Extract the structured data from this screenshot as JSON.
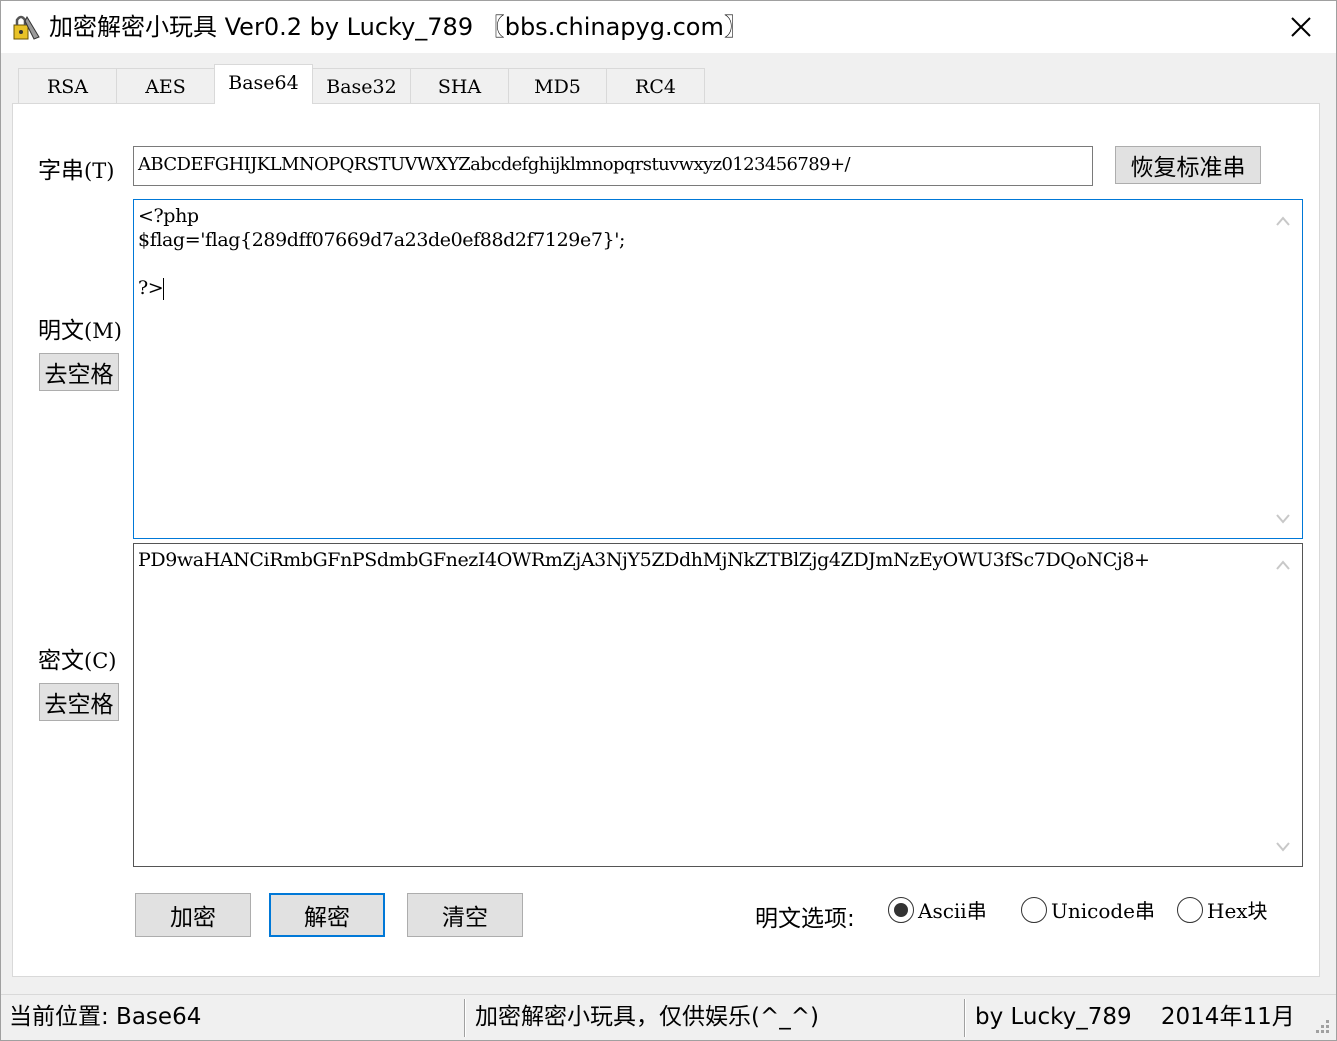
{
  "window": {
    "title": "加密解密小玩具 Ver0.2 by Lucky_789 〖bbs.chinapyg.com〗"
  },
  "tabs": [
    {
      "label": "RSA",
      "active": false
    },
    {
      "label": "AES",
      "active": false
    },
    {
      "label": "Base64",
      "active": true
    },
    {
      "label": "Base32",
      "active": false
    },
    {
      "label": "SHA",
      "active": false
    },
    {
      "label": "MD5",
      "active": false
    },
    {
      "label": "RC4",
      "active": false
    }
  ],
  "charset": {
    "label": "字串",
    "hotkey": "(T)",
    "value": "ABCDEFGHIJKLMNOPQRSTUVWXYZabcdefghijklmnopqrstuvwxyz0123456789+/",
    "restore_button": "恢复标准串"
  },
  "plaintext": {
    "label": "明文",
    "hotkey": "(M)",
    "strip_button": "去空格",
    "lines": [
      "<?php",
      "$flag='flag{289dff07669d7a23de0ef88d2f7129e7}';",
      "",
      "?>"
    ]
  },
  "ciphertext": {
    "label": "密文",
    "hotkey": "(C)",
    "strip_button": "去空格",
    "value": "PD9waHANCiRmbGFnPSdmbGFnezI4OWRmZjA3NjY5ZDdhMjNkZTBlZjg4ZDJmNzEyOWU3fSc7DQoNCj8+"
  },
  "actions": {
    "encrypt": "加密",
    "decrypt": "解密",
    "clear": "清空"
  },
  "options": {
    "label": "明文选项:",
    "radios": [
      {
        "label": "Ascii串",
        "checked": true
      },
      {
        "label": "Unicode串",
        "checked": false
      },
      {
        "label": "Hex块",
        "checked": false
      }
    ]
  },
  "status": {
    "location": "当前位置: Base64",
    "slogan": "加密解密小玩具，仅供娱乐(^_^)",
    "author": "by Lucky_789    2014年11月"
  }
}
